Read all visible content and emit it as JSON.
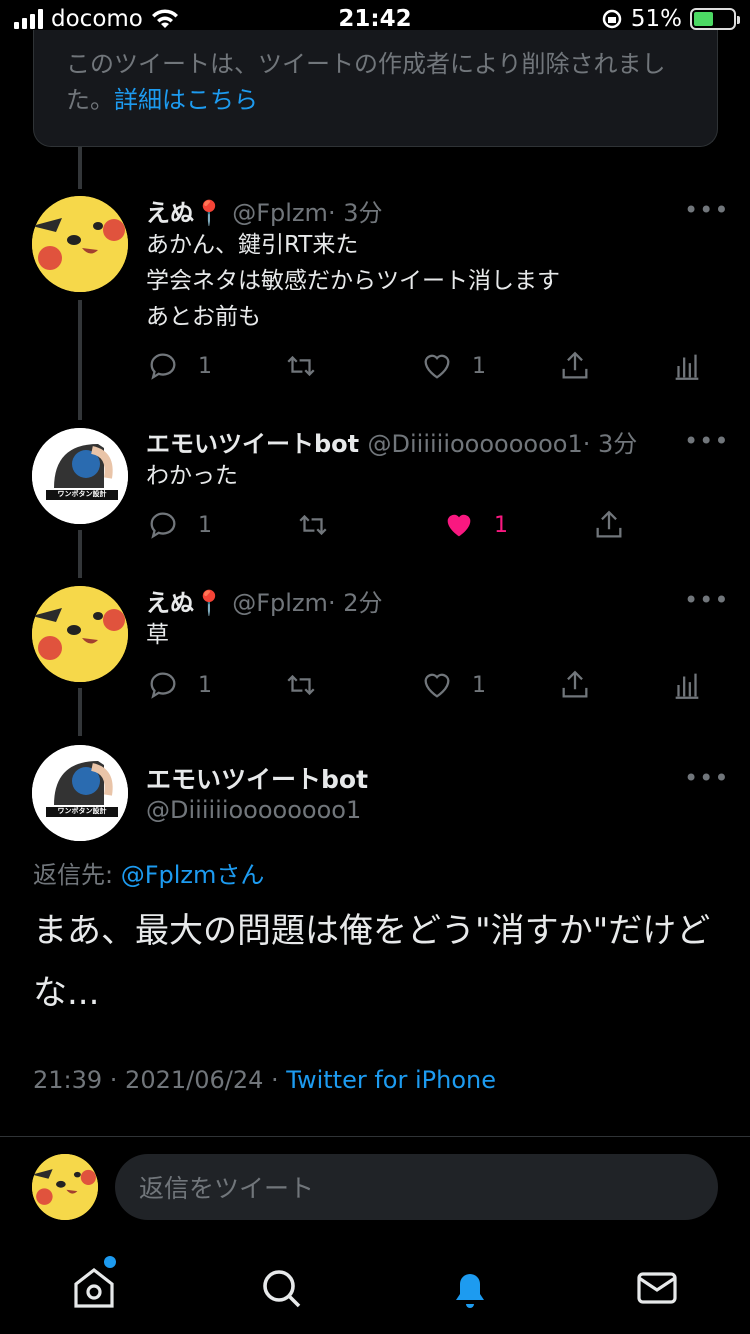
{
  "status_bar": {
    "carrier": "docomo",
    "time": "21:42",
    "battery": "51%"
  },
  "deleted_tweet": {
    "text": "このツイートは、ツイートの作成者により削除されました。",
    "link": "詳細はこちら"
  },
  "tweets": [
    {
      "name": "えぬ📍",
      "handle": "@Fplzm",
      "time": "· 3分",
      "lines": [
        "あかん、鍵引RT来た",
        "学会ネタは敏感だからツイート消します",
        "あとお前も"
      ],
      "replies": "1",
      "likes": "1"
    },
    {
      "name": "エモいツイートbot",
      "handle": "@Diiiiiioooooooo1",
      "time": "· 3分",
      "lines": [
        "わかった"
      ],
      "replies": "1",
      "likes": "1"
    },
    {
      "name": "えぬ📍",
      "handle": "@Fplzm",
      "time": "· 2分",
      "lines": [
        "草"
      ],
      "replies": "1",
      "likes": "1"
    }
  ],
  "main_tweet": {
    "name": "エモいツイートbot",
    "handle": "@Diiiiiioooooooo1",
    "reply_to_label": "返信先: ",
    "reply_to_handle": "@Fplzmさん",
    "text": "まあ、最大の問題は俺をどう\"消すか\"だけどな...",
    "time": "21:39 · 2021/06/24 · ",
    "app": "Twitter for iPhone"
  },
  "bot_avatar_label": "ワンボタン設計",
  "more_label": "•••",
  "reply_placeholder": "返信をツイート",
  "colors": {
    "accent": "#1d9bf0",
    "like": "#f91880",
    "muted": "#71767b"
  },
  "icons": [
    "home-icon",
    "search-icon",
    "notifications-icon",
    "messages-icon"
  ]
}
